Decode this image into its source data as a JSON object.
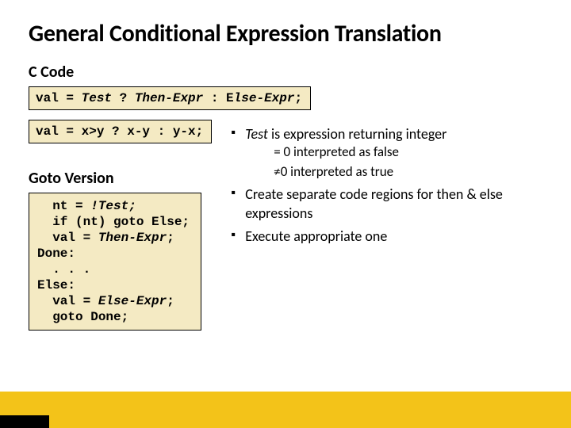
{
  "title": "General Conditional Expression Translation",
  "section_c": "C Code",
  "code_general": "val = Test ? Then-Expr : Else-Expr;",
  "code_example": "val = x>y ? x-y : y-x;",
  "section_goto": "Goto Version",
  "goto_code_lines": [
    "  nt = !Test;",
    "  if (nt) goto Else;",
    "  val = Then-Expr;",
    "Done:",
    "  . . .",
    "Else:",
    "  val = Else-Expr;",
    "  goto Done;"
  ],
  "bullets": {
    "b1_lead": "Test",
    "b1_rest": " is expression returning integer",
    "b1_sub1": "= 0 interpreted as false",
    "b1_sub2_pre": "≠",
    "b1_sub2_rest": "0 interpreted as true",
    "b2": "Create separate code regions for then & else expressions",
    "b3": "Execute appropriate one"
  }
}
